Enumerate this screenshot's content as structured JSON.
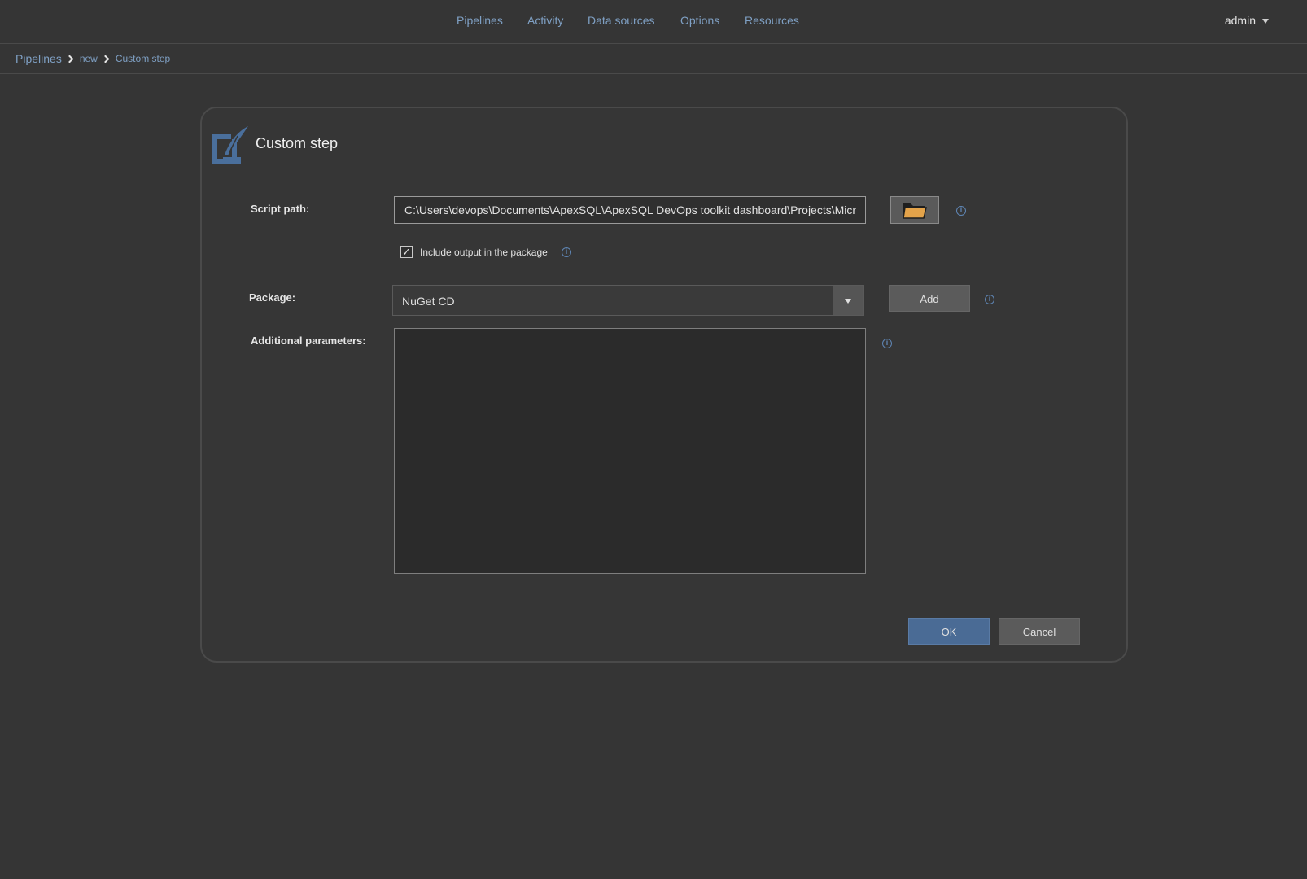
{
  "nav": {
    "items": [
      "Pipelines",
      "Activity",
      "Data sources",
      "Options",
      "Resources"
    ],
    "user": "admin"
  },
  "breadcrumb": [
    "Pipelines",
    "new",
    "Custom step"
  ],
  "dialog": {
    "title": "Custom step",
    "script_path": {
      "label": "Script path:",
      "value": "C:\\Users\\devops\\Documents\\ApexSQL\\ApexSQL DevOps toolkit dashboard\\Projects\\Micr"
    },
    "include_output": {
      "label": "Include output in the package",
      "checked": true
    },
    "package": {
      "label": "Package:",
      "selected": "NuGet CD",
      "add_label": "Add"
    },
    "additional_parameters": {
      "label": "Additional parameters:",
      "value": ""
    },
    "ok_label": "OK",
    "cancel_label": "Cancel"
  },
  "colors": {
    "background": "#353535",
    "link": "#7fa0c4",
    "primary_button": "#4a6b95",
    "icon_blue": "#4a6f9c",
    "folder": "#e3a34a"
  },
  "icons": [
    "custom-step-icon",
    "folder-icon",
    "info-icon",
    "chevron-right-icon",
    "caret-down-icon",
    "checkmark-icon"
  ]
}
